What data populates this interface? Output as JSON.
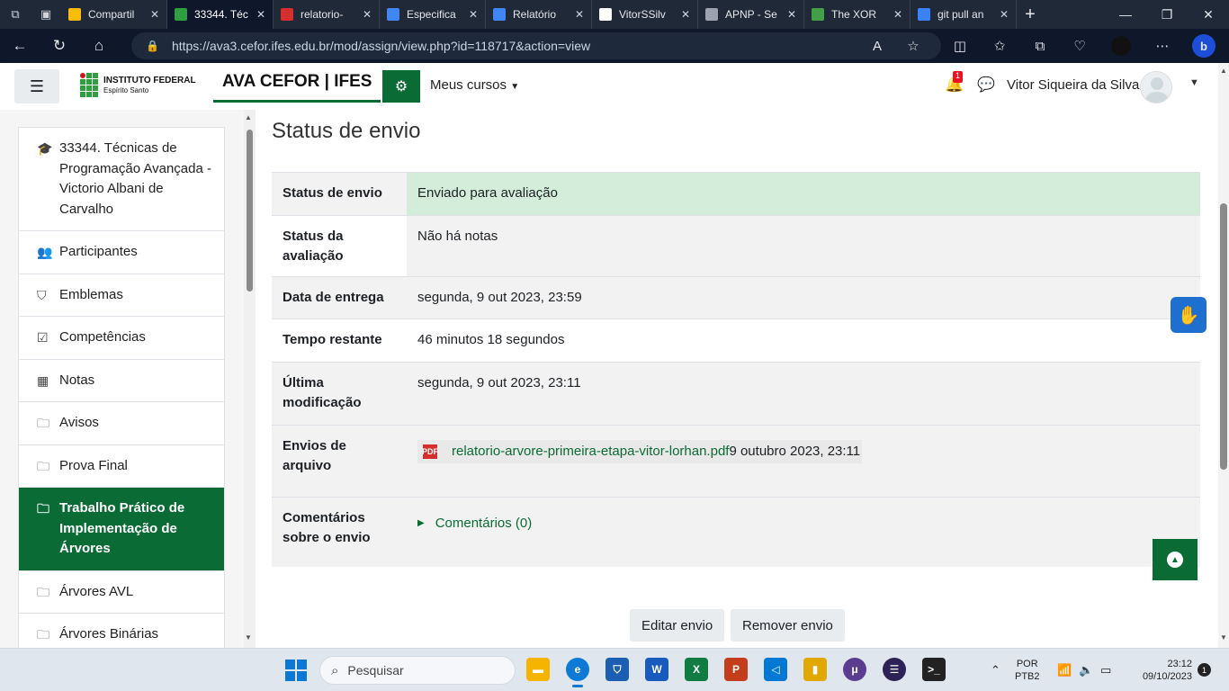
{
  "browser": {
    "tabs": [
      {
        "title": "Compartil",
        "color": "#fbbc04",
        "active": false
      },
      {
        "title": "33344. Téc",
        "color": "#2f9e41",
        "active": true
      },
      {
        "title": "relatorio-",
        "color": "#d32f2f",
        "active": false
      },
      {
        "title": "Especifica",
        "color": "#4285f4",
        "active": false
      },
      {
        "title": "Relatório",
        "color": "#4285f4",
        "active": false
      },
      {
        "title": "VitorSSilv",
        "color": "#ffffff",
        "active": false
      },
      {
        "title": "APNP - Se",
        "color": "#9ca3af",
        "active": false
      },
      {
        "title": "The XOR",
        "color": "#43a047",
        "active": false
      },
      {
        "title": "git pull an",
        "color": "#3b82f6",
        "active": false
      }
    ],
    "url": "https://ava3.cefor.ifes.edu.br/mod/assign/view.php?id=118717&action=view"
  },
  "navbar": {
    "logo_title": "INSTITUTO FEDERAL",
    "logo_subtitle": "Espírito Santo",
    "site_name": "AVA CEFOR | IFES",
    "my_courses": "Meus cursos",
    "notification_count": "1",
    "user_name": "Vitor Siqueira da Silva"
  },
  "drawer": {
    "items": [
      {
        "icon": "graduation-cap-icon",
        "glyph": "🎓",
        "label": "33344. Técnicas de Programação Avançada - Victorio Albani de Carvalho",
        "active": false
      },
      {
        "icon": "users-icon",
        "glyph": "👥",
        "label": "Participantes",
        "active": false
      },
      {
        "icon": "shield-icon",
        "glyph": "⛉",
        "label": "Emblemas",
        "active": false
      },
      {
        "icon": "checkbox-icon",
        "glyph": "☑",
        "label": "Competências",
        "active": false
      },
      {
        "icon": "table-icon",
        "glyph": "▦",
        "label": "Notas",
        "active": false
      },
      {
        "icon": "folder-icon",
        "glyph": "🗀",
        "label": "Avisos",
        "active": false
      },
      {
        "icon": "folder-icon",
        "glyph": "🗀",
        "label": "Prova Final",
        "active": false
      },
      {
        "icon": "folder-icon",
        "glyph": "🗀",
        "label": "Trabalho Prático de Implementação de Árvores",
        "active": true
      },
      {
        "icon": "folder-icon",
        "glyph": "🗀",
        "label": "Árvores AVL",
        "active": false
      },
      {
        "icon": "folder-icon",
        "glyph": "🗀",
        "label": "Árvores Binárias",
        "active": false
      }
    ]
  },
  "main": {
    "title": "Status de envio",
    "rows": {
      "status": {
        "label": "Status de envio",
        "value": "Enviado para avaliação"
      },
      "grading": {
        "label": "Status da avaliação",
        "value": "Não há notas"
      },
      "due": {
        "label": "Data de entrega",
        "value": "segunda, 9 out 2023, 23:59"
      },
      "remaining": {
        "label": "Tempo restante",
        "value": "46 minutos 18 segundos"
      },
      "modified": {
        "label": "Última modificação",
        "value": "segunda, 9 out 2023, 23:11"
      },
      "files": {
        "label": "Envios de arquivo",
        "filename": "relatorio-arvore-primeira-etapa-vitor-lorhan.pdf",
        "filedate": "9 outubro 2023, 23:11"
      },
      "comments": {
        "label": "Comentários sobre o envio",
        "value": "Comentários (0)"
      }
    },
    "edit_button": "Editar envio",
    "remove_button": "Remover envio"
  },
  "taskbar": {
    "search_placeholder": "Pesquisar",
    "language": "POR",
    "layout": "PTB2",
    "time": "23:12",
    "date": "09/10/2023",
    "notification_count": "1"
  },
  "colors": {
    "brand_green": "#0b6b35",
    "success_bg": "#d4edda"
  }
}
